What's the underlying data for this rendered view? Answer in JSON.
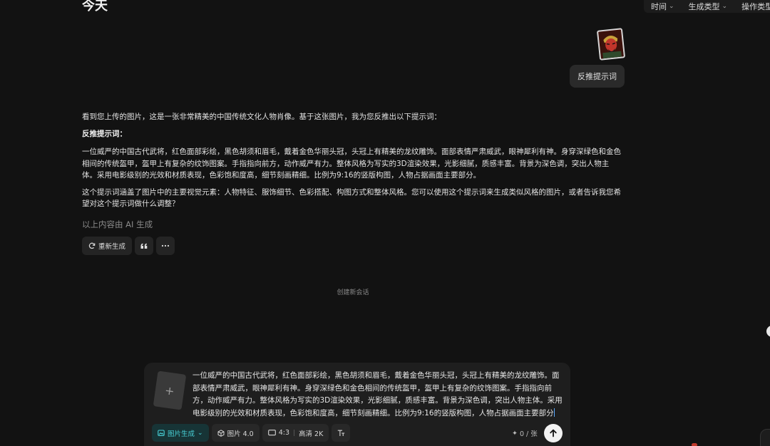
{
  "history": {
    "day_label": "今天"
  },
  "filters": {
    "time_label": "时间",
    "gen_type_label": "生成类型",
    "op_type_label": "操作类型"
  },
  "user_message": {
    "text": "反推提示词"
  },
  "assistant": {
    "intro": "看到您上传的图片，这是一张非常精美的中国传统文化人物肖像。基于这张图片，我为您反推出以下提示词：",
    "heading": "反推提示词：",
    "prompt": "一位威严的中国古代武将，红色面部彩绘，黑色胡须和眉毛，戴着金色华丽头冠，头冠上有精美的龙纹雕饰。面部表情严肃威武，眼神犀利有神。身穿深绿色和金色相间的传统盔甲，盔甲上有复杂的纹饰图案。手指指向前方，动作威严有力。整体风格为写实的3D渲染效果，光影细腻，质感丰富。背景为深色调，突出人物主体。采用电影级别的光效和材质表现，色彩饱和度高，细节刻画精细。比例为9:16的竖版构图，人物占据画面主要部分。",
    "summary": "这个提示词涵盖了图片中的主要视觉元素：人物特征、服饰细节、色彩搭配、构图方式和整体风格。您可以使用这个提示词来生成类似风格的图片，或者告诉我您希望对这个提示词做什么调整？",
    "ai_note": "以上内容由 AI 生成",
    "regenerate_label": "重新生成"
  },
  "new_session_label": "创建新会话",
  "composer": {
    "text": "一位威严的中国古代武将，红色面部彩绘，黑色胡须和眉毛，戴着金色华丽头冠，头冠上有精美的龙纹雕饰。面部表情严肃威武，眼神犀利有神。身穿深绿色和金色相间的传统盔甲，盔甲上有复杂的纹饰图案。手指指向前方，动作威严有力。整体风格为写实的3D渲染效果，光影细腻，质感丰富。背景为深色调，突出人物主体。采用电影级别的光效和材质表现，色彩饱和度高，细节刻画精细。比例为9:16的竖版构图，人物占据画面主要部分",
    "mode_label": "图片生成",
    "model_label": "图片 4.0",
    "ratio_label": "4:3",
    "quality_label": "高清 2K",
    "credits_label": "0 / 张"
  },
  "colors": {
    "background": "#121212",
    "accent": "#48d0d6",
    "bubble": "#2a2a2a"
  }
}
